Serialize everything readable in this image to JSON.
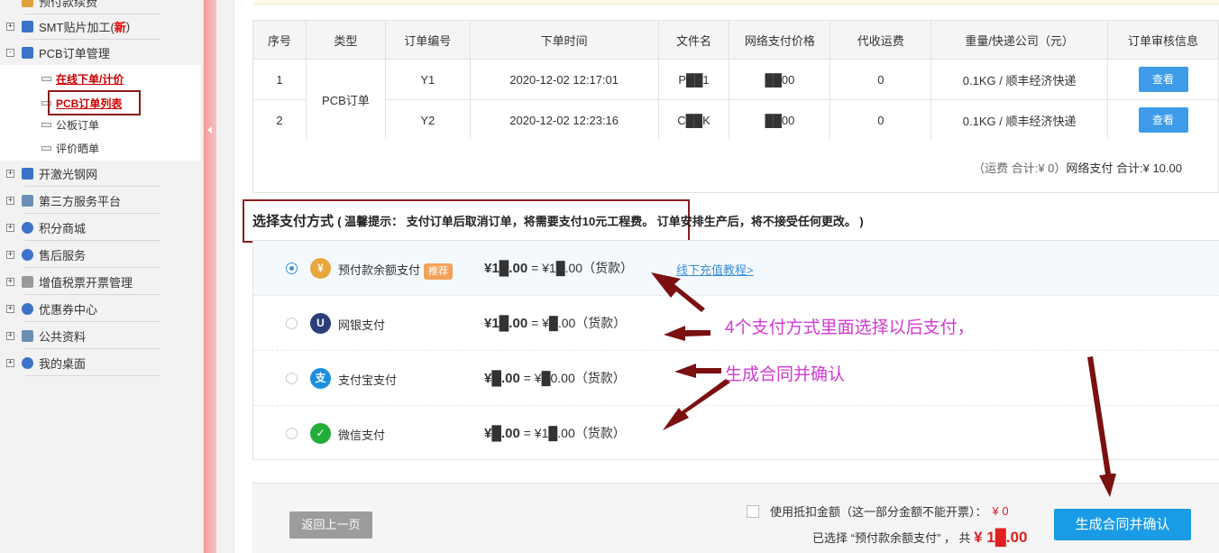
{
  "sidebar": {
    "top_partial_label": "预付款续费",
    "items": [
      {
        "expander": "+",
        "label": "SMT贴片加工(",
        "label_red": "新",
        "label_end": ")",
        "icon_color": "#3b73c8"
      },
      {
        "expander": "-",
        "label": "PCB订单管理",
        "icon_color": "#3b73c8"
      },
      {
        "expander": "+",
        "label": "开激光钢网",
        "icon_color": "#3b73c8"
      },
      {
        "expander": "+",
        "label": "第三方服务平台",
        "icon_color": "#6a8fb5"
      },
      {
        "expander": "+",
        "label": "积分商城",
        "icon_color": "#3b73c8"
      },
      {
        "expander": "+",
        "label": "售后服务",
        "icon_color": "#3b73c8"
      },
      {
        "expander": "+",
        "label": "增值税票开票管理",
        "icon_color": "#777777"
      },
      {
        "expander": "+",
        "label": "优惠券中心",
        "icon_color": "#3b73c8"
      },
      {
        "expander": "+",
        "label": "公共资料",
        "icon_color": "#6a8fb5"
      },
      {
        "expander": "+",
        "label": "我的桌面",
        "icon_color": "#3b73c8"
      }
    ],
    "sub_items": [
      "在线下单/计价",
      "PCB订单列表",
      "公板订单",
      "评价晒单"
    ]
  },
  "table": {
    "headers": [
      "序号",
      "类型",
      "订单编号",
      "下单时间",
      "文件名",
      "网络支付价格",
      "代收运费",
      "重量/快递公司（元）",
      "订单审核信息"
    ],
    "type_cell": "PCB订单",
    "rows": [
      {
        "index": "1",
        "order_no": "Y1",
        "time": "2020-12-02 12:17:01",
        "file": "P██1",
        "price": "██00",
        "freight": "0",
        "weight": "0.1KG / 顺丰经济快递",
        "action": "查看"
      },
      {
        "index": "2",
        "order_no": "Y2",
        "time": "2020-12-02 12:23:16",
        "file": "C██K",
        "price": "██00",
        "freight": "0",
        "weight": "0.1KG / 顺丰经济快递",
        "action": "查看"
      }
    ]
  },
  "summary": {
    "freight": "（运费 合计:¥ 0）",
    "net": "网络支付 合计:¥ 10.00"
  },
  "payment": {
    "title": "选择支付方式",
    "tip": "( 温馨提示： 支付订单后取消订单，将需要支付10元工程费。 订单安排生产后，将不接受任何更改。 )",
    "methods": [
      {
        "name": "预付款余额支付",
        "badge": "推荐",
        "amount": "¥1█.00",
        "equals": "= ¥1█.00（货款）",
        "icon_glyph": "¥",
        "icon_color": "#e8a73c",
        "selected": true
      },
      {
        "name": "网银支付",
        "amount": "¥1█.00",
        "equals": "= ¥█.00（货款）",
        "icon_glyph": "U",
        "icon_color": "#2c3e7a",
        "selected": false
      },
      {
        "name": "支付宝支付",
        "amount": "¥█.00",
        "equals": "= ¥█0.00（货款）",
        "icon_glyph": "支",
        "icon_color": "#1a8fe0",
        "selected": false
      },
      {
        "name": "微信支付",
        "amount": "¥█.00",
        "equals": "= ¥1█.00（货款）",
        "icon_glyph": "✓",
        "icon_color": "#22ac38",
        "selected": false
      }
    ],
    "recharge_link": "线下充值教程>"
  },
  "annotations": {
    "line1": "4个支付方式里面选择以后支付，",
    "line2": "生成合同并确认",
    "arrow_color": "#7a1010"
  },
  "footer": {
    "back_label": "返回上一页",
    "deduct_label": "使用抵扣金额（这一部分金额不能开票）：",
    "deduct_value": "¥ 0",
    "chosen_label": "已选择 “预付款余额支付” ， 共",
    "chosen_total": "¥ 1█.00",
    "confirm_label": "生成合同并确认"
  }
}
